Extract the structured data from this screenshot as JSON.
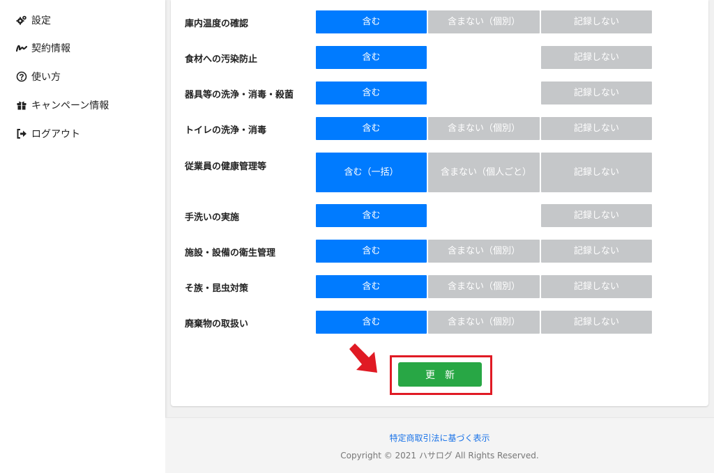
{
  "sidebar": {
    "items": [
      {
        "label": "設定",
        "icon": "gears-icon"
      },
      {
        "label": "契約情報",
        "icon": "signature-icon"
      },
      {
        "label": "使い方",
        "icon": "question-circle-icon"
      },
      {
        "label": "キャンペーン情報",
        "icon": "gift-icon"
      },
      {
        "label": "ログアウト",
        "icon": "sign-out-icon"
      }
    ]
  },
  "rows": [
    {
      "label": "庫内温度の確認",
      "include": "含む",
      "exclude": "含まない（個別）",
      "norecord": "記録しない"
    },
    {
      "label": "食材への汚染防止",
      "include": "含む",
      "exclude": "",
      "norecord": "記録しない"
    },
    {
      "label": "器具等の洗浄・消毒・殺菌",
      "include": "含む",
      "exclude": "",
      "norecord": "記録しない"
    },
    {
      "label": "トイレの洗浄・消毒",
      "include": "含む",
      "exclude": "含まない（個別）",
      "norecord": "記録しない"
    },
    {
      "label": "従業員の健康管理等",
      "include": "含む（一括）",
      "exclude": "含まない（個人ごと）",
      "norecord": "記録しない"
    },
    {
      "label": "手洗いの実施",
      "include": "含む",
      "exclude": "",
      "norecord": "記録しない"
    },
    {
      "label": "施設・設備の衛生管理",
      "include": "含む",
      "exclude": "含まない（個別）",
      "norecord": "記録しない"
    },
    {
      "label": "そ族・昆虫対策",
      "include": "含む",
      "exclude": "含まない（個別）",
      "norecord": "記録しない"
    },
    {
      "label": "廃棄物の取扱い",
      "include": "含む",
      "exclude": "含まない（個別）",
      "norecord": "記録しない"
    }
  ],
  "update_button": "更　新",
  "footer": {
    "link": "特定商取引法に基づく表示",
    "copyright": "Copyright © 2021 ハサログ All Rights Reserved."
  },
  "colors": {
    "selected": "#007bff",
    "unselected": "#c5c7c9",
    "update": "#28a745",
    "highlight": "#e01a24"
  }
}
